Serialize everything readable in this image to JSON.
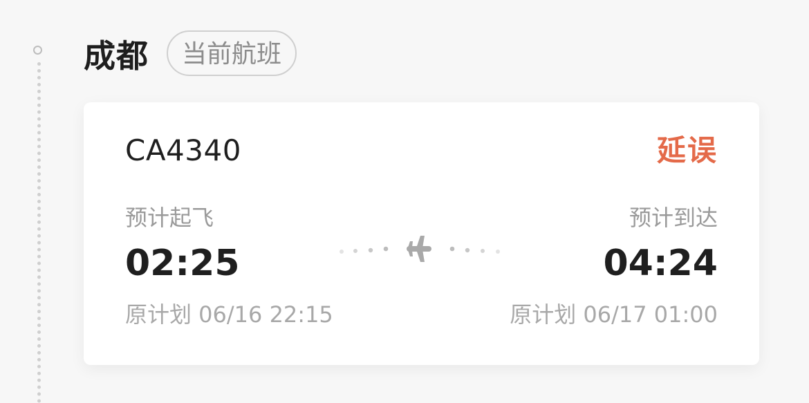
{
  "header": {
    "city": "成都",
    "badge": "当前航班"
  },
  "flight": {
    "number": "CA4340",
    "status": "延误",
    "status_color": "#e46a49",
    "departure": {
      "label": "预计起飞",
      "time": "02:25",
      "original": "原计划 06/16 22:15"
    },
    "arrival": {
      "label": "预计到达",
      "time": "04:24",
      "original": "原计划 06/17 01:00"
    },
    "route_icon": "airplane-icon"
  }
}
